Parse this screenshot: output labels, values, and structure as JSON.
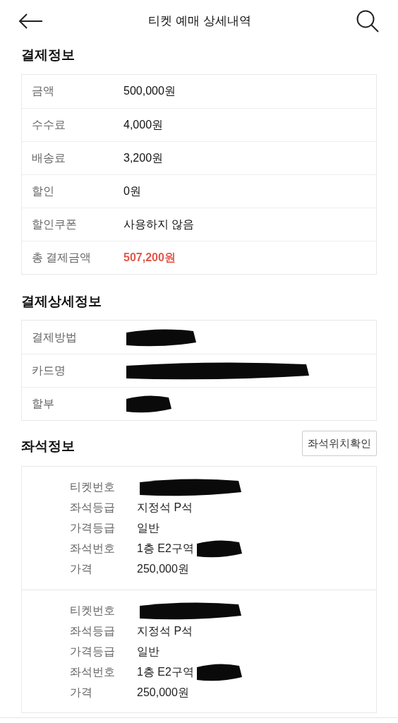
{
  "header": {
    "title": "티켓 예매 상세내역"
  },
  "payment": {
    "title": "결제정보",
    "rows": [
      {
        "label": "금액",
        "value": "500,000원"
      },
      {
        "label": "수수료",
        "value": "4,000원"
      },
      {
        "label": "배송료",
        "value": "3,200원"
      },
      {
        "label": "할인",
        "value": "0원"
      },
      {
        "label": "할인쿠폰",
        "value": "사용하지 않음"
      },
      {
        "label": "총 결제금액",
        "value": "507,200원",
        "highlight": true
      }
    ]
  },
  "payment_detail": {
    "title": "결제상세정보",
    "rows": [
      {
        "label": "결제방법",
        "redacted": true
      },
      {
        "label": "카드명",
        "redacted": true
      },
      {
        "label": "할부",
        "redacted": true
      }
    ]
  },
  "seats": {
    "title": "좌석정보",
    "button": "좌석위치확인",
    "tickets": [
      {
        "rows": [
          {
            "label": "티켓번호",
            "redacted": true
          },
          {
            "label": "좌석등급",
            "value": "지정석 P석"
          },
          {
            "label": "가격등급",
            "value": "일반"
          },
          {
            "label": "좌석번호",
            "value": "1층 E2구역",
            "redacted": true
          },
          {
            "label": "가격",
            "value": "250,000원"
          }
        ]
      },
      {
        "rows": [
          {
            "label": "티켓번호",
            "redacted": true
          },
          {
            "label": "좌석등급",
            "value": "지정석 P석"
          },
          {
            "label": "가격등급",
            "value": "일반"
          },
          {
            "label": "좌석번호",
            "value": "1층 E2구역",
            "redacted": true
          },
          {
            "label": "가격",
            "value": "250,000원"
          }
        ]
      }
    ]
  }
}
